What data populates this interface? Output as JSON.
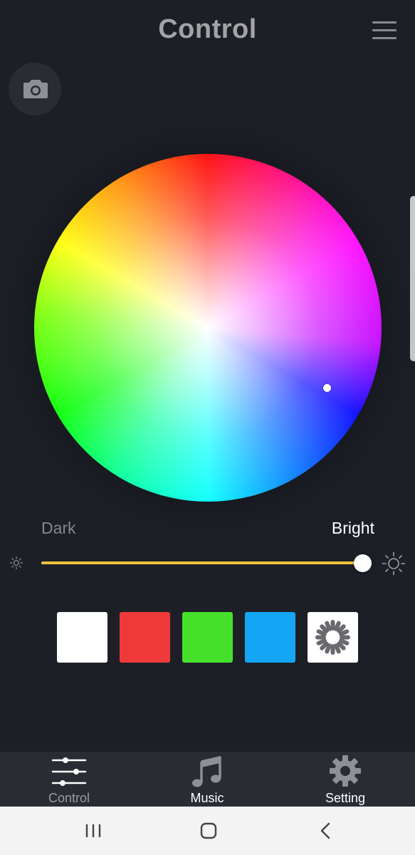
{
  "header": {
    "title": "Control",
    "menu_icon": "hamburger-menu-icon",
    "camera_icon": "camera-icon"
  },
  "color_wheel": {
    "selected_color_hint": "blue-violet"
  },
  "brightness": {
    "min_label": "Dark",
    "max_label": "Bright",
    "value_fraction": 1.0,
    "accent_color": "#f0c23b"
  },
  "presets": [
    {
      "name": "white",
      "color": "#ffffff"
    },
    {
      "name": "red",
      "color": "#f03a3a"
    },
    {
      "name": "green",
      "color": "#45e02a"
    },
    {
      "name": "blue",
      "color": "#14a6f4"
    },
    {
      "name": "effect",
      "color": "#ffffff",
      "icon": "loading-spinner-icon"
    }
  ],
  "bottom_nav": {
    "items": [
      {
        "label": "Control",
        "icon": "sliders-icon",
        "active": true
      },
      {
        "label": "Music",
        "icon": "music-note-icon",
        "active": false
      },
      {
        "label": "Setting",
        "icon": "gear-icon",
        "active": false
      }
    ]
  },
  "system_nav": {
    "recents_icon": "recents-icon",
    "home_icon": "home-icon",
    "back_icon": "back-icon"
  }
}
